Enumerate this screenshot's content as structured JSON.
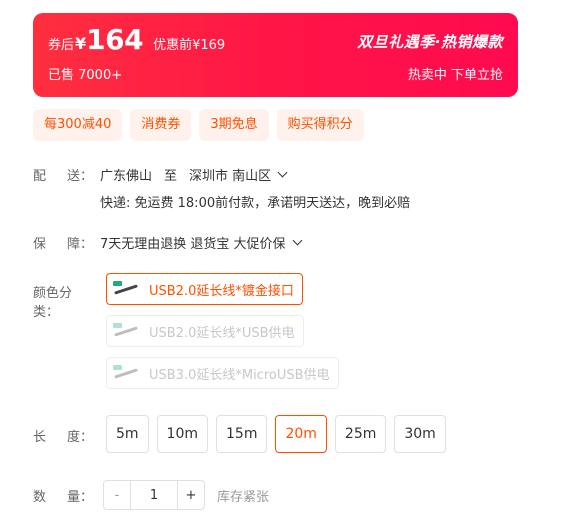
{
  "price_banner": {
    "coupon_label": "券后",
    "currency": "¥",
    "price": "164",
    "original_price": "优惠前¥169",
    "sold": "已售 7000+",
    "promo_title": "双旦礼遇季·热销爆款",
    "promo_sub": "热卖中 下单立抢"
  },
  "tags": [
    "每300减40",
    "消费券",
    "3期免息",
    "购买得积分"
  ],
  "delivery": {
    "label_a": "配",
    "label_b": "送：",
    "from": "广东佛山",
    "to_word": "至",
    "dest": "深圳市 南山区",
    "note": "快递: 免运费  18:00前付款，承诺明天送达，晚到必赔"
  },
  "service": {
    "label_a": "保",
    "label_b": "障：",
    "text": "7天无理由退换 退货宝 大促价保"
  },
  "color": {
    "label": "颜色分类：",
    "options": [
      {
        "label": "USB2.0延长线*镀金接口",
        "state": "selected"
      },
      {
        "label": "USB2.0延长线*USB供电",
        "state": "disabled"
      },
      {
        "label": "USB3.0延长线*MicroUSB供电",
        "state": "disabled"
      }
    ]
  },
  "length": {
    "label_a": "长",
    "label_b": "度：",
    "options": [
      "5m",
      "10m",
      "15m",
      "20m",
      "25m",
      "30m"
    ],
    "selected": "20m"
  },
  "quantity": {
    "label_a": "数",
    "label_b": "量：",
    "minus": "-",
    "value": "1",
    "plus": "+",
    "stock": "库存紧张"
  },
  "colors": {
    "accent": "#ff5000",
    "banner": "#ff1546",
    "tag_bg": "#fff1eb"
  }
}
